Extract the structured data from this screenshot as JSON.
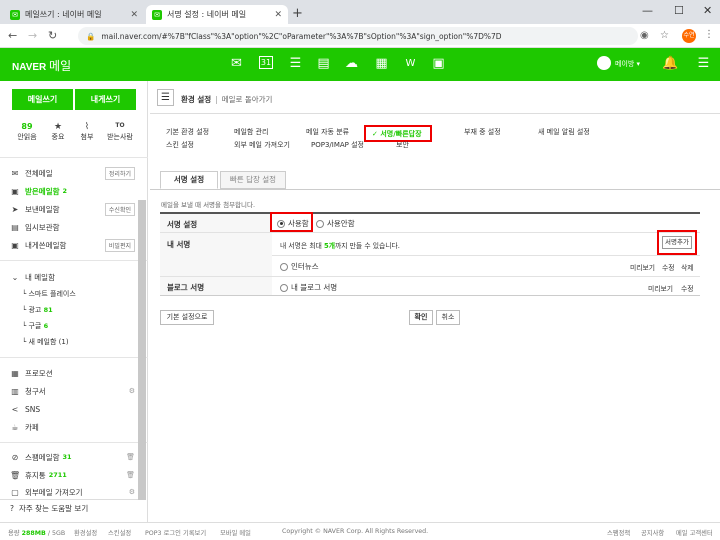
{
  "browser": {
    "tabs": [
      {
        "title": "메일쓰기 : 네이버 메일"
      },
      {
        "title": "서명 설정 : 네이버 메일"
      }
    ],
    "url": "mail.naver.com/#%7B\"fClass\"%3A\"option\"%2C\"oParameter\"%3A%7B\"sOption\"%3A\"sign_option\"%7D%7D",
    "profile_badge": "수연"
  },
  "header": {
    "logo": "NAVER",
    "logo_suffix": "메일",
    "username": "메이방 ▾",
    "icons": [
      "mail-icon",
      "calendar-icon",
      "list-icon",
      "contacts-icon",
      "cloud-icon",
      "grid-icon",
      "word-icon",
      "text-icon"
    ]
  },
  "sidebar": {
    "write_button": "메일쓰기",
    "self_button": "내게쓰기",
    "stats": [
      {
        "count": "89",
        "icon": "",
        "label": "안읽음"
      },
      {
        "count": "",
        "icon": "★",
        "label": "중요"
      },
      {
        "count": "",
        "icon": "⌇",
        "label": "첨부"
      },
      {
        "count": "",
        "icon": "TO",
        "label": "받는사람"
      }
    ],
    "folders": [
      {
        "icon": "✉",
        "label": "전체메일",
        "count": "",
        "tag": "정리하기"
      },
      {
        "icon": "▣",
        "label": "받은메일함",
        "count": "2",
        "tag": ""
      },
      {
        "icon": "➤",
        "label": "보낸메일함",
        "count": "",
        "tag": "수신확인"
      },
      {
        "icon": "▤",
        "label": "임시보관함",
        "count": "",
        "tag": ""
      },
      {
        "icon": "▣",
        "label": "내게쓴메일함",
        "count": "",
        "tag": "비밀편지"
      }
    ],
    "my_mailbox_title": "내 메일함",
    "sub_folders": [
      {
        "label": "스마트 플레이스",
        "count": ""
      },
      {
        "label": "광고",
        "count": "81"
      },
      {
        "label": "구글",
        "count": "6"
      },
      {
        "label": "새 메일함 (1)",
        "count": ""
      }
    ],
    "extras": [
      {
        "icon": "▦",
        "label": "프로모션"
      },
      {
        "icon": "▥",
        "label": "청구서"
      },
      {
        "icon": "<",
        "label": "SNS"
      },
      {
        "icon": "☕",
        "label": "카페"
      }
    ],
    "bottom": [
      {
        "icon": "⊘",
        "label": "스팸메일함",
        "count": "31"
      },
      {
        "icon": "🗑",
        "label": "휴지통",
        "count": "2711"
      },
      {
        "icon": "▢",
        "label": "외부메일 가져오기",
        "count": ""
      }
    ],
    "faq": "자주 찾는 도움말 보기"
  },
  "main": {
    "breadcrumb_title": "환경 설정",
    "breadcrumb_back": "메일로 돌아가기",
    "menu": {
      "row1": [
        "기본 환경 설정",
        "메일함 관리",
        "메일 자동 분류",
        "서명/빠른답장",
        "부재 중 설정",
        "새 메일 알림 설정"
      ],
      "row2": [
        "스킨 설정",
        "외부 메일 가져오기",
        "POP3/IMAP 설정",
        "보안"
      ]
    },
    "tabs": [
      "서명 설정",
      "빠른 답장 설정"
    ],
    "description": "메일을 보낼 때 서명을 첨부합니다.",
    "rows": {
      "sig_setting": "서명 설정",
      "my_sig": "내 서명",
      "blog_sig": "블로그 서명"
    },
    "use_on": "사용함",
    "use_off": "사용안함",
    "limit_text_pre": "내 서명은 최대 ",
    "limit_count": "5개",
    "limit_text_post": "까지 만들 수 있습니다.",
    "add_sig": "서명추가",
    "sig_item": "인터뉴스",
    "blog_item": "내 블로그 서명",
    "preview": "미리보기",
    "edit": "수정",
    "delete": "삭제",
    "default_btn": "기본 설정으로",
    "ok_btn": "확인",
    "cancel_btn": "취소"
  },
  "footer": {
    "capacity_label": "용량",
    "capacity_value": "288MB",
    "capacity_total": "/ 5GB",
    "links": [
      "환경설정",
      "스킨설정",
      "POP3 로그인 기록보기",
      "모바일 메일"
    ],
    "copyright": "Copyright © NAVER Corp. All Rights Reserved.",
    "right_links": [
      "스팸정책",
      "공지사항",
      "메일 고객센터"
    ]
  }
}
